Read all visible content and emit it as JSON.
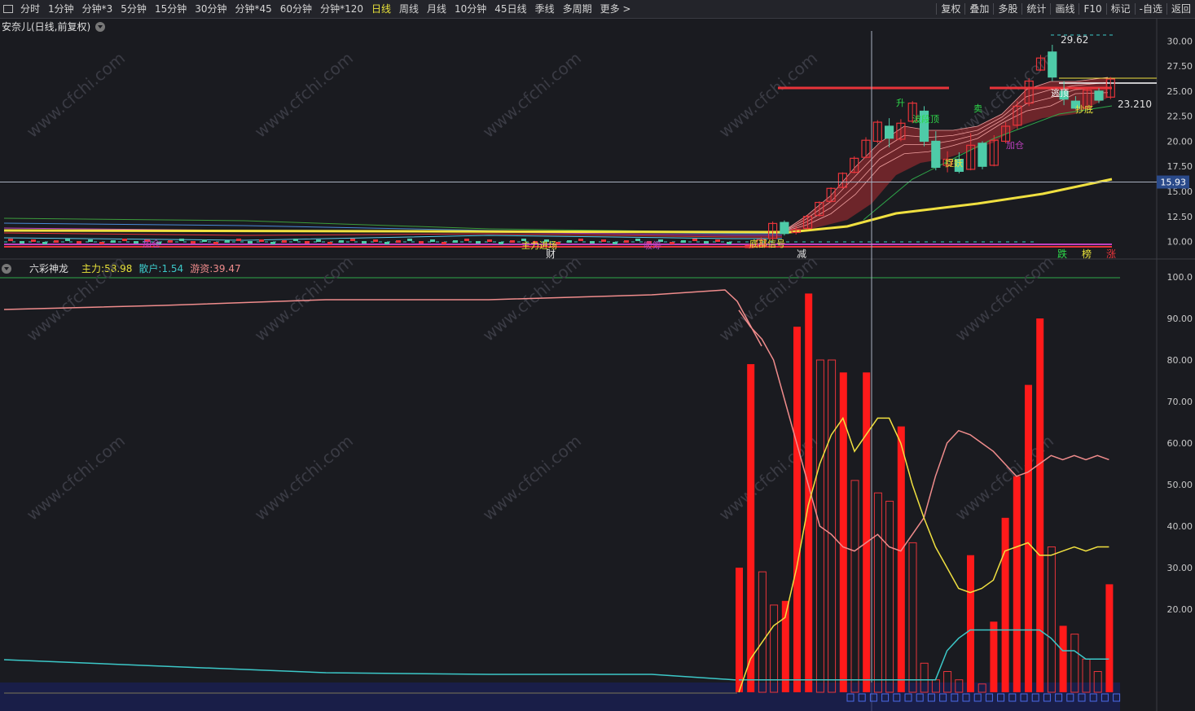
{
  "toolbar": {
    "left_items": [
      "分时",
      "1分钟",
      "分钟*3",
      "5分钟",
      "15分钟",
      "30分钟",
      "分钟*45",
      "60分钟",
      "分钟*120",
      "日线",
      "周线",
      "月线",
      "10分钟",
      "45日线",
      "季线",
      "多周期",
      "更多 >"
    ],
    "active": "日线",
    "right_items": [
      "复权",
      "叠加",
      "多股",
      "统计",
      "画线",
      "F10",
      "标记",
      "-自选",
      "返回"
    ]
  },
  "main_chart": {
    "title": "安奈儿(日线,前复权)",
    "y_ticks": [
      "30.00",
      "27.50",
      "25.00",
      "22.50",
      "20.00",
      "17.50",
      "15.00",
      "12.50",
      "10.00"
    ],
    "crosshair_price": "15.93",
    "high_label": "29.62",
    "mid_label": "23.210",
    "bottom_labels": [
      "财",
      "减",
      "跌",
      "榜",
      "涨"
    ],
    "annotations": [
      "波段顶",
      "卖",
      "逃顶",
      "抄底",
      "加仓",
      "捉妖",
      "升",
      "加仓",
      "主力进场",
      "吸筹",
      "底部信号"
    ]
  },
  "indicator": {
    "name": "六彩神龙",
    "legend": [
      {
        "label": "主力:",
        "value": "58.98",
        "color": "#e8e23a"
      },
      {
        "label": "散户:",
        "value": "1.54",
        "color": "#3cc8c8"
      },
      {
        "label": "游资:",
        "value": "39.47",
        "color": "#f08c8c"
      }
    ],
    "y_ticks": [
      "100.0",
      "90.00",
      "80.00",
      "70.00",
      "60.00",
      "50.00",
      "40.00",
      "30.00",
      "20.00"
    ]
  },
  "watermark": "www.cfchi.com",
  "colors": {
    "up": "#e8343a",
    "down": "#4ecba8",
    "ma_yellow": "#f0e040",
    "bg": "#1a1b20"
  },
  "chart_data": [
    {
      "type": "candlestick",
      "title": "安奈儿(日线,前复权)",
      "ylim": [
        8.5,
        31
      ],
      "x_count": 60,
      "candles": [
        [
          29,
          9.4,
          9.6,
          9.3,
          9.8
        ],
        [
          30,
          9.6,
          10.2,
          9.5,
          10.4
        ],
        [
          31,
          10.3,
          11.8,
          10.2,
          12.0
        ],
        [
          32,
          11.9,
          10.8,
          10.6,
          12.1
        ],
        [
          33,
          10.9,
          11.2,
          10.7,
          11.5
        ],
        [
          34,
          11.3,
          12.5,
          11.2,
          12.7
        ],
        [
          35,
          12.6,
          13.9,
          12.5,
          14.0
        ],
        [
          36,
          14.0,
          15.3,
          13.9,
          15.4
        ],
        [
          37,
          15.4,
          16.8,
          15.3,
          16.9
        ],
        [
          38,
          16.9,
          18.3,
          16.8,
          18.5
        ],
        [
          39,
          18.4,
          20.1,
          18.3,
          20.4
        ],
        [
          40,
          20.0,
          21.9,
          19.8,
          22.1
        ],
        [
          41,
          21.5,
          20.3,
          19.4,
          22.3
        ],
        [
          42,
          20.2,
          21.8,
          20.0,
          22.2
        ],
        [
          43,
          22.0,
          23.8,
          21.8,
          24.0
        ],
        [
          44,
          23.0,
          20.0,
          19.5,
          23.5
        ],
        [
          45,
          20.0,
          17.4,
          17.1,
          21.0
        ],
        [
          46,
          17.6,
          18.2,
          16.9,
          19.0
        ],
        [
          47,
          18.2,
          17.0,
          16.8,
          18.9
        ],
        [
          48,
          17.2,
          19.6,
          17.1,
          20.8
        ],
        [
          49,
          19.8,
          17.5,
          17.2,
          20.0
        ],
        [
          50,
          17.6,
          20.1,
          17.5,
          20.6
        ],
        [
          51,
          20.0,
          21.5,
          19.8,
          21.9
        ],
        [
          52,
          21.6,
          23.5,
          21.2,
          24.0
        ],
        [
          53,
          23.8,
          26.0,
          23.5,
          26.3
        ],
        [
          54,
          27.1,
          28.3,
          27.0,
          28.6
        ],
        [
          55,
          28.9,
          26.4,
          26.0,
          29.62
        ],
        [
          56,
          25.0,
          24.2,
          23.6,
          26.0
        ],
        [
          57,
          24.0,
          23.3,
          23.2,
          24.5
        ],
        [
          58,
          23.3,
          25.1,
          23.1,
          25.4
        ],
        [
          59,
          25.0,
          24.1,
          23.8,
          25.3
        ],
        [
          60,
          24.4,
          26.2,
          24.2,
          26.4
        ]
      ]
    },
    {
      "type": "bar+line",
      "name": "六彩神龙",
      "ylim": [
        0,
        100
      ],
      "series": [
        {
          "name": "主力",
          "values": [
            30,
            79,
            29,
            21,
            22,
            88,
            96,
            80,
            80,
            77,
            51,
            77,
            48,
            46,
            64,
            36,
            7,
            3,
            5,
            3,
            33,
            2,
            17,
            42,
            52,
            74,
            90,
            35,
            16,
            14,
            8,
            5,
            26
          ]
        },
        {
          "name": "散户",
          "values": [
            3,
            3,
            3,
            3,
            3,
            3,
            3,
            3,
            3,
            3,
            3,
            3,
            3,
            3,
            3,
            3,
            3,
            3,
            10,
            13,
            15,
            15,
            15,
            15,
            15,
            15,
            15,
            13,
            10,
            10,
            8,
            8,
            8
          ]
        },
        {
          "name": "游资",
          "values": [
            92,
            88,
            85,
            80,
            70,
            60,
            50,
            40,
            38,
            35,
            34,
            36,
            38,
            35,
            34,
            38,
            42,
            52,
            60,
            63,
            62,
            60,
            58,
            55,
            52,
            53,
            55,
            57,
            56,
            57,
            56,
            57,
            56
          ]
        }
      ]
    }
  ]
}
